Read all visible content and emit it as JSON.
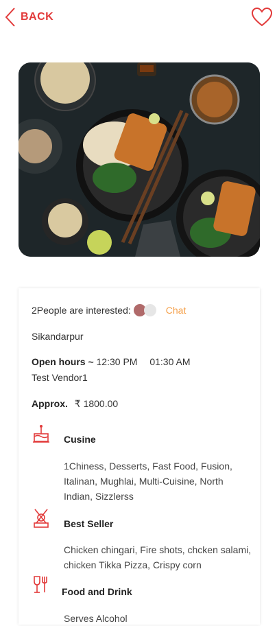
{
  "header": {
    "back_label": "BACK"
  },
  "details": {
    "interested_text": "2People are interested:",
    "chat_label": "Chat",
    "location": "Sikandarpur",
    "open_hours_label": "Open hours ~",
    "open_time": "12:30 PM",
    "close_time": "01:30 AM",
    "vendor": "Test Vendor1",
    "approx_label": "Approx.",
    "approx_price": "₹ 1800.00"
  },
  "sections": {
    "cuisine": {
      "title": "Cusine",
      "body": "1Chiness, Desserts, Fast Food, Fusion, Italinan, Mughlai, Multi-Cuisine, North Indian, Sizzlerss"
    },
    "best_seller": {
      "title": "Best Seller",
      "body": "Chicken chingari, Fire shots, chcken salami, chicken Tikka Pizza, Crispy corn"
    },
    "food_drink": {
      "title": "Food and Drink",
      "body": "Serves Alcohol"
    }
  },
  "colors": {
    "accent": "#e23a3a",
    "chat": "#f5a04a"
  },
  "icons": {
    "back": "chevron-left-icon",
    "favorite": "heart-icon",
    "cuisine": "cake-icon",
    "best_seller": "award-icon",
    "food_drink": "wine-glass-icon"
  }
}
